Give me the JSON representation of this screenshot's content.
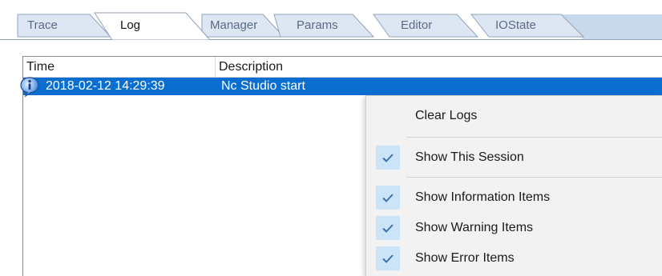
{
  "tabs": [
    {
      "label": "Trace",
      "active": false
    },
    {
      "label": "Log",
      "active": true
    },
    {
      "label": "Manager",
      "active": false
    },
    {
      "label": "Params",
      "active": false
    },
    {
      "label": "Editor",
      "active": false
    },
    {
      "label": "IOState",
      "active": false
    }
  ],
  "log_table": {
    "columns": [
      "Time",
      "Description"
    ],
    "rows": [
      {
        "icon": "info-icon",
        "time": "2018-02-12 14:29:39",
        "description": "Nc Studio start",
        "selected": true
      }
    ]
  },
  "context_menu": {
    "items": [
      {
        "label": "Clear Logs",
        "checked": false
      },
      {
        "label": "Show This Session",
        "checked": true
      },
      {
        "label": "Show Information Items",
        "checked": true
      },
      {
        "label": "Show Warning Items",
        "checked": true
      },
      {
        "label": "Show Error Items",
        "checked": true
      }
    ]
  },
  "colors": {
    "selection": "#0a6ed1",
    "menu_background": "#f2f2f2",
    "check_highlight": "#cce4f7",
    "tab_strip": "#c9d9ec"
  }
}
